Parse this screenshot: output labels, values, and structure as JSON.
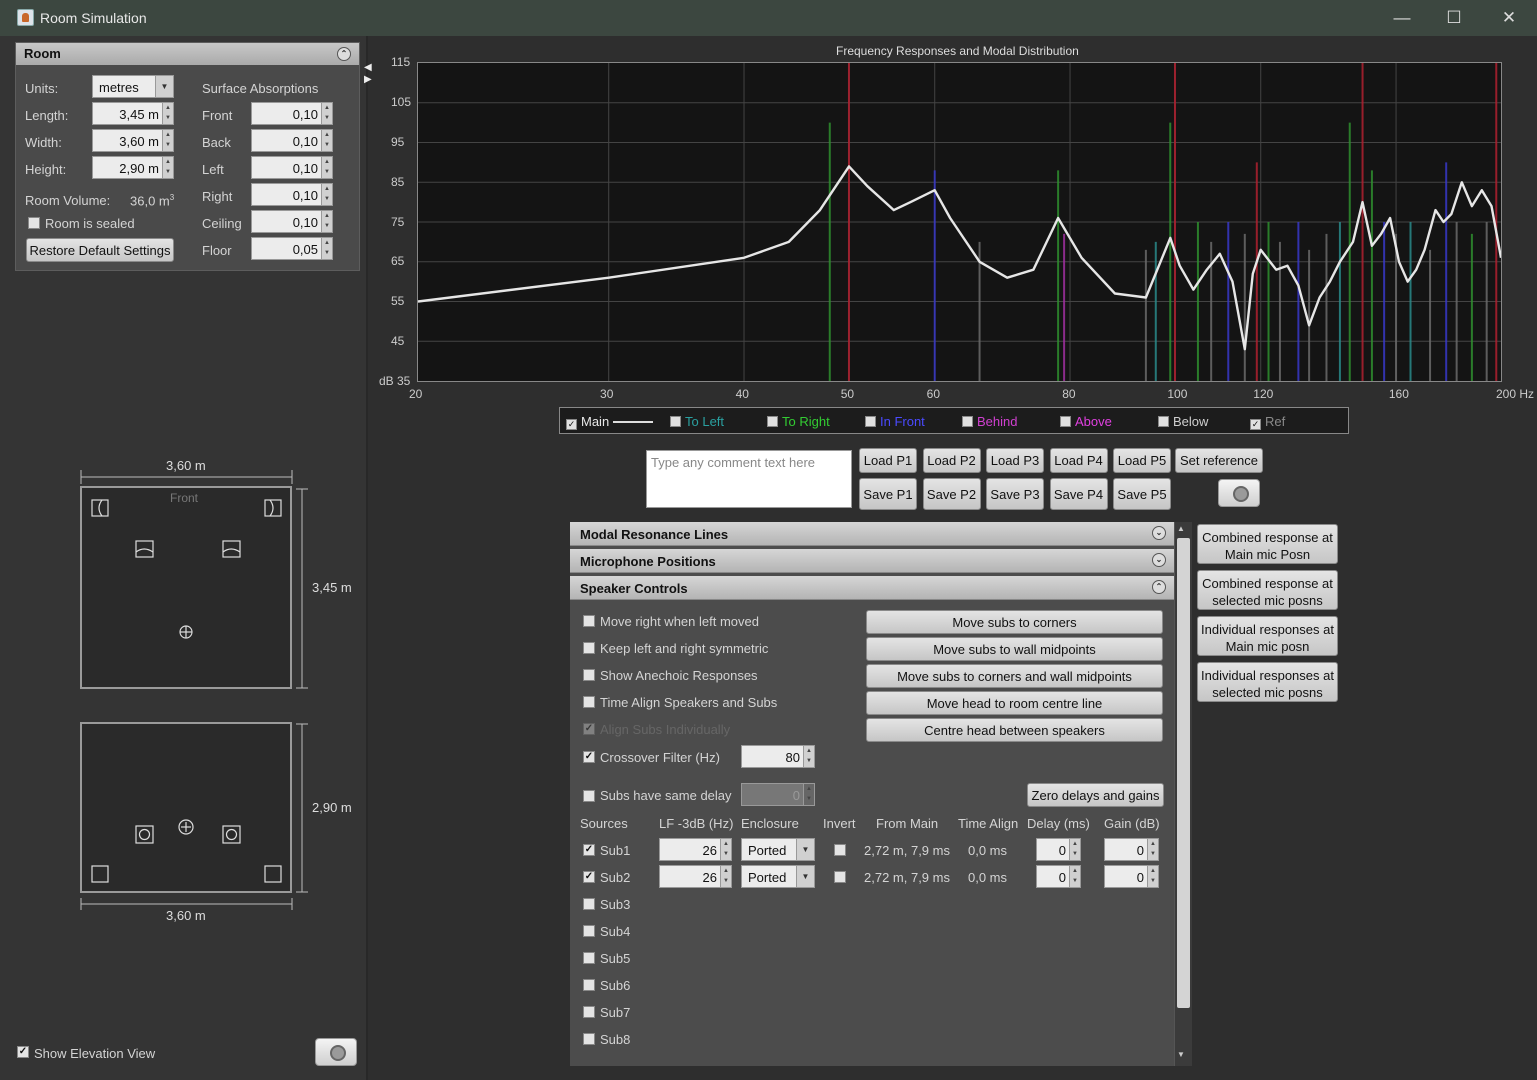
{
  "window": {
    "title": "Room Simulation",
    "minimize": "—",
    "maximize": "☐",
    "close": "✕"
  },
  "room": {
    "header": "Room",
    "units_label": "Units:",
    "units_value": "metres",
    "length_label": "Length:",
    "length_value": "3,45 m",
    "width_label": "Width:",
    "width_value": "3,60 m",
    "height_label": "Height:",
    "height_value": "2,90 m",
    "volume_label": "Room Volume:",
    "volume_value": "36,0 m",
    "volume_exp": "3",
    "sealed_label": "Room is sealed",
    "restore_button": "Restore Default Settings",
    "absorptions_header": "Surface Absorptions",
    "surfaces": [
      {
        "label": "Front",
        "value": "0,10"
      },
      {
        "label": "Back",
        "value": "0,10"
      },
      {
        "label": "Left",
        "value": "0,10"
      },
      {
        "label": "Right",
        "value": "0,10"
      },
      {
        "label": "Ceiling",
        "value": "0,10"
      },
      {
        "label": "Floor",
        "value": "0,05"
      }
    ]
  },
  "plan": {
    "width_dim": "3,60 m",
    "length_dim": "3,45 m",
    "front_label": "Front"
  },
  "elevation": {
    "height_dim": "2,90 m",
    "width_dim": "3,60 m"
  },
  "show_elevation": "Show Elevation View",
  "plot": {
    "title": "Frequency Responses and Modal Distribution",
    "y_ticks": [
      "115",
      "105",
      "95",
      "85",
      "75",
      "65",
      "55",
      "45",
      "dB 35"
    ],
    "x_ticks": [
      "20",
      "30",
      "40",
      "50",
      "60",
      "80",
      "100",
      "120",
      "160",
      "200 Hz"
    ],
    "colors": {
      "curve": "#e6e6e6",
      "red": "#b02030",
      "green": "#2f8f2f",
      "blue": "#3838c8",
      "grey": "#6a6a6a",
      "teal": "#2a8a8a",
      "magenta": "#a030a0"
    }
  },
  "legend": [
    {
      "label": "Main",
      "color": "#e8e8e8",
      "checked": true
    },
    {
      "label": "To Left",
      "color": "#2aa0a0",
      "checked": false
    },
    {
      "label": "To Right",
      "color": "#33cc33",
      "checked": false
    },
    {
      "label": "In Front",
      "color": "#4a4aff",
      "checked": false
    },
    {
      "label": "Behind",
      "color": "#d040d0",
      "checked": false
    },
    {
      "label": "Above",
      "color": "#e040e0",
      "checked": false
    },
    {
      "label": "Below",
      "color": "#cfcfcf",
      "checked": false
    },
    {
      "label": "Ref",
      "color": "#8a8a8a",
      "checked": true
    }
  ],
  "comment": {
    "placeholder": "Type any comment text here"
  },
  "load_buttons": [
    "Load P1",
    "Load P2",
    "Load P3",
    "Load P4",
    "Load P5"
  ],
  "set_reference": "Set reference",
  "save_buttons": [
    "Save P1",
    "Save P2",
    "Save P3",
    "Save P4",
    "Save P5"
  ],
  "panels": {
    "modal": "Modal Resonance Lines",
    "mic": "Microphone Positions",
    "speaker": "Speaker Controls"
  },
  "speaker": {
    "options": [
      "Move right when left moved",
      "Keep left and right symmetric",
      "Show Anechoic Responses",
      "Time Align Speakers and Subs",
      "Align Subs Individually"
    ],
    "crossover_label": "Crossover Filter (Hz)",
    "crossover_value": "80",
    "same_delay_label": "Subs have same delay",
    "same_delay_value": "0",
    "move_buttons": [
      "Move subs to corners",
      "Move subs to wall midpoints",
      "Move subs to corners and wall midpoints",
      "Move head to room centre line",
      "Centre head between speakers"
    ],
    "zero_button": "Zero delays and gains",
    "columns": [
      "Sources",
      "LF -3dB (Hz)",
      "Enclosure",
      "Invert",
      "From Main",
      "Time Align",
      "Delay (ms)",
      "Gain (dB)"
    ],
    "subs": [
      {
        "name": "Sub1",
        "checked": true,
        "lf": "26",
        "enclosure": "Ported",
        "from_main": "2,72 m, 7,9 ms",
        "time_align": "0,0 ms",
        "delay": "0",
        "gain": "0"
      },
      {
        "name": "Sub2",
        "checked": true,
        "lf": "26",
        "enclosure": "Ported",
        "from_main": "2,72 m, 7,9 ms",
        "time_align": "0,0 ms",
        "delay": "0",
        "gain": "0"
      },
      {
        "name": "Sub3",
        "checked": false
      },
      {
        "name": "Sub4",
        "checked": false
      },
      {
        "name": "Sub5",
        "checked": false
      },
      {
        "name": "Sub6",
        "checked": false
      },
      {
        "name": "Sub7",
        "checked": false
      },
      {
        "name": "Sub8",
        "checked": false
      }
    ]
  },
  "right_buttons": [
    "Combined response at Main mic Posn",
    "Combined response at selected mic posns",
    "Individual responses at Main mic posn",
    "Individual responses at selected mic posns"
  ]
}
